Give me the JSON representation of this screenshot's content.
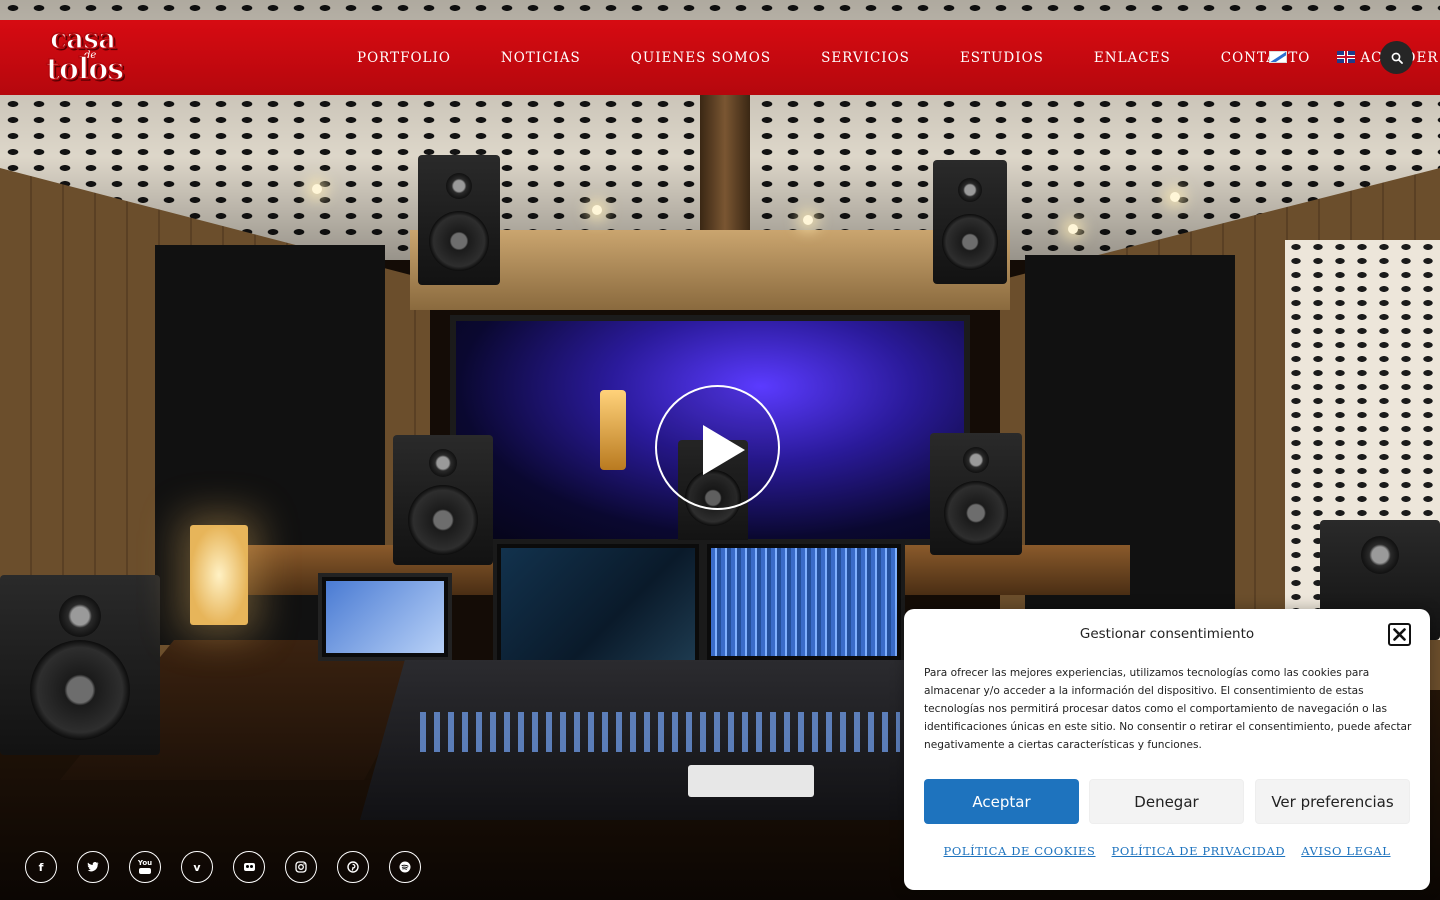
{
  "brand": {
    "logo_top": "casa",
    "logo_mid": "de",
    "logo_bottom": "tolos",
    "primary_color": "#c8080f",
    "accent_color": "#1e73be"
  },
  "nav": {
    "items": [
      "PORTFOLIO",
      "NOTICIAS",
      "QUIENES SOMOS",
      "SERVICIOS",
      "ESTUDIOS",
      "ENLACES",
      "CONTACTO",
      "ACCEDER"
    ],
    "flags": [
      "galician-flag-icon",
      "uk-flag-icon"
    ],
    "search_icon": "search-icon"
  },
  "hero": {
    "play_icon": "play-icon"
  },
  "social": {
    "icons": [
      "facebook-icon",
      "twitter-icon",
      "youtube-icon",
      "vimeo-icon",
      "flickr-icon",
      "instagram-icon",
      "pinterest-icon",
      "spotify-icon"
    ],
    "glyphs": [
      "f",
      "t",
      "You",
      "v",
      "••",
      "◎",
      "℗",
      "≋"
    ]
  },
  "consent": {
    "title": "Gestionar consentimiento",
    "body": "Para ofrecer las mejores experiencias, utilizamos tecnologías como las cookies para almacenar y/o acceder a la información del dispositivo. El consentimiento de estas tecnologías nos permitirá procesar datos como el comportamiento de navegación o las identificaciones únicas en este sitio. No consentir o retirar el consentimiento, puede afectar negativamente a ciertas características y funciones.",
    "accept_label": "Aceptar",
    "deny_label": "Denegar",
    "prefs_label": "Ver preferencias",
    "links": [
      "POLÍTICA DE COOKIES",
      "POLÍTICA DE PRIVACIDAD",
      "AVISO LEGAL"
    ]
  }
}
